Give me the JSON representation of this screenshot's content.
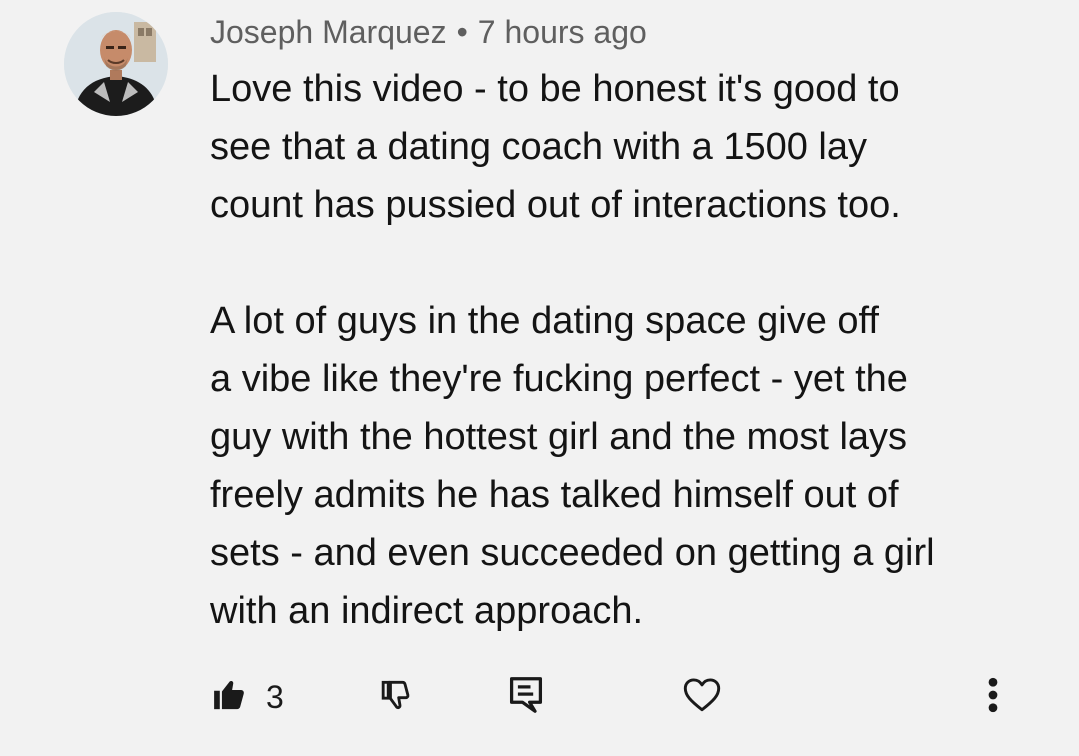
{
  "comment": {
    "author": "Joseph Marquez",
    "separator": "•",
    "timestamp": "7 hours ago",
    "paragraphs": [
      "Love this video - to be honest it's good to\nsee that a dating coach with a 1500 lay\ncount has pussied out of interactions too.",
      "A lot of guys in the dating space give off\na vibe like they're fucking perfect - yet the\nguy with the hottest girl and the most lays\nfreely admits he has talked himself out of\nsets - and even succeeded on getting a girl\nwith an indirect approach."
    ]
  },
  "actions": {
    "like_count": "3",
    "icons": {
      "like": "thumbs-up-filled-icon",
      "dislike": "thumbs-down-icon",
      "reply": "reply-comment-icon",
      "heart": "heart-outline-icon",
      "more": "more-vertical-icon"
    }
  },
  "colors": {
    "background": "#f2f2f2",
    "text": "#141414",
    "meta": "#5f5f5f",
    "icon": "#1a1a1a"
  }
}
